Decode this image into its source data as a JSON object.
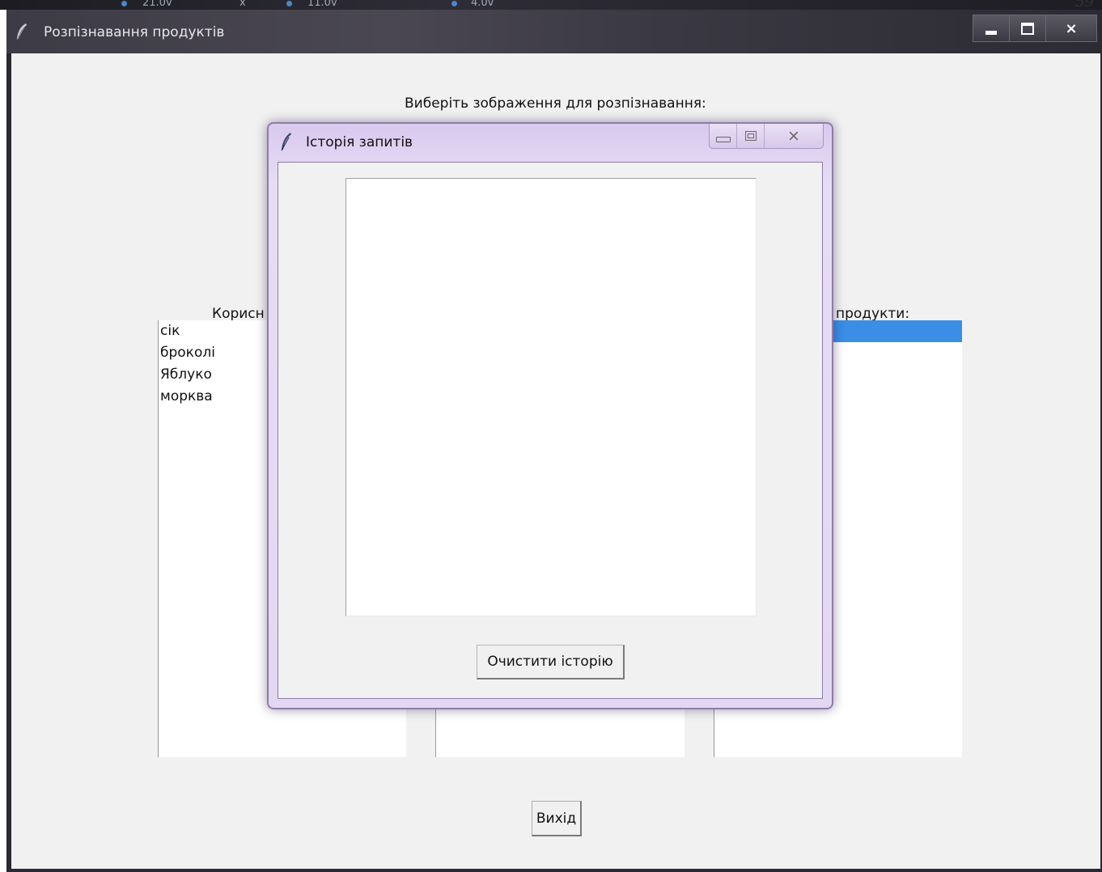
{
  "background": {
    "fragments": [
      "21.0v",
      "x",
      "11.0v",
      "4.0v"
    ],
    "page_number": "59"
  },
  "main_window": {
    "title": "Розпізнавання продуктів",
    "app_icon": "feather-icon",
    "controls": {
      "minimize": "minimize-icon",
      "maximize": "maximize-icon",
      "close": "×"
    },
    "prompt": "Виберіть зображення для розпізнавання:",
    "left_column_label": "Корисн",
    "right_column_label": "продукти:",
    "left_list": [
      "сік",
      "броколі",
      "Яблуко",
      "морква"
    ],
    "exit_button": "Вихід"
  },
  "history_dialog": {
    "title": "Історія запитів",
    "app_icon": "feather-icon",
    "controls": {
      "minimize": "minimize-icon",
      "maximize": "maximize-icon",
      "close": "⨯"
    },
    "history_items": [],
    "clear_button": "Очистити історію"
  },
  "colors": {
    "selection": "#3a8ee6",
    "dialog_frame": "#d9c9ee",
    "client_bg": "#f1f1f1"
  }
}
